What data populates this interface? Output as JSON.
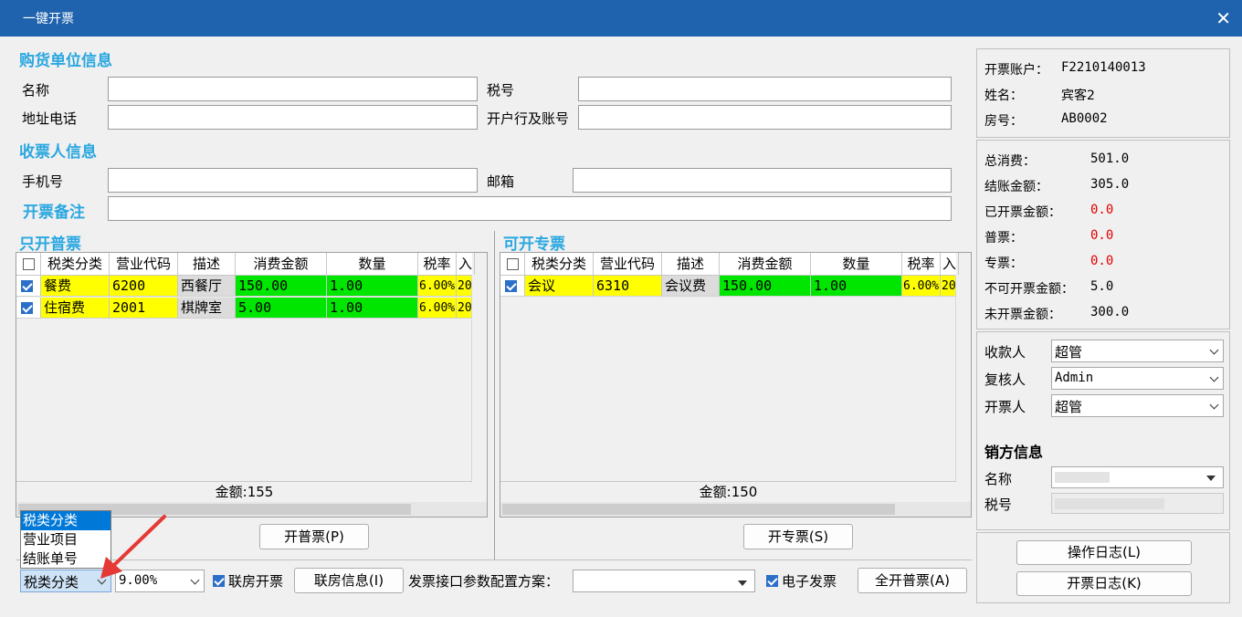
{
  "window": {
    "title": "一键开票",
    "close": "✕"
  },
  "buyer": {
    "section_title": "购货单位信息",
    "name_label": "名称",
    "name_value": "",
    "tax_label": "税号",
    "tax_value": "",
    "address_label": "地址电话",
    "address_value": "",
    "bank_label": "开户行及账号",
    "bank_value": ""
  },
  "receiver": {
    "section_title": "收票人信息",
    "phone_label": "手机号",
    "phone_value": "",
    "email_label": "邮箱",
    "email_value": "",
    "remark_label": "开票备注",
    "remark_value": ""
  },
  "general_invoice": {
    "title": "只开普票",
    "columns": [
      "税类分类",
      "营业代码",
      "描述",
      "消费金额",
      "数量",
      "税率",
      "入"
    ],
    "rows": [
      {
        "category": "餐费",
        "code": "6200",
        "desc": "西餐厅",
        "amount": "150.00",
        "qty": "1.00",
        "rate": "6.00%",
        "extra": "20"
      },
      {
        "category": "住宿费",
        "code": "2001",
        "desc": "棋牌室",
        "amount": "5.00",
        "qty": "1.00",
        "rate": "6.00%",
        "extra": "20"
      }
    ],
    "footer": "金额:155",
    "button": "开普票(P)"
  },
  "special_invoice": {
    "title": "可开专票",
    "columns": [
      "税类分类",
      "营业代码",
      "描述",
      "消费金额",
      "数量",
      "税率",
      "入"
    ],
    "rows": [
      {
        "category": "会议",
        "code": "6310",
        "desc": "会议费",
        "amount": "150.00",
        "qty": "1.00",
        "rate": "6.00%",
        "extra": "20"
      }
    ],
    "footer": "金额:150",
    "button": "开专票(S)"
  },
  "account": {
    "account_label": "开票账户：",
    "account_value": "F2210140013",
    "name_label": "姓名：",
    "name_value": "宾客2",
    "room_label": "房号：",
    "room_value": "AB0002"
  },
  "summary": [
    {
      "label": "总消费：",
      "value": "501.0",
      "color": "#000000"
    },
    {
      "label": "结账金额：",
      "value": "305.0",
      "color": "#000000"
    },
    {
      "label": "已开票金额：",
      "value": "0.0",
      "color": "#e00000"
    },
    {
      "label": "普票：",
      "value": "0.0",
      "color": "#e00000"
    },
    {
      "label": "专票：",
      "value": "0.0",
      "color": "#e00000"
    },
    {
      "label": "不可开票金额：",
      "value": "5.0",
      "color": "#000000"
    },
    {
      "label": "未开票金额：",
      "value": "300.0",
      "color": "#000000"
    }
  ],
  "staff": {
    "payee_label": "收款人",
    "payee_value": "超管",
    "reviewer_label": "复核人",
    "reviewer_value": "Admin",
    "issuer_label": "开票人",
    "issuer_value": "超管"
  },
  "seller": {
    "title": "销方信息",
    "name_label": "名称",
    "name_value": "",
    "tax_label": "税号",
    "tax_value": ""
  },
  "logs": {
    "operation_log": "操作日志(L)",
    "invoice_log": "开票日志(K)"
  },
  "bottom": {
    "group_select": "税类分类",
    "group_options": [
      "税类分类",
      "营业项目",
      "结账单号"
    ],
    "rate_select": "9.00%",
    "room_link_checkbox": "联房开票",
    "room_info_button": "联房信息(I)",
    "config_label": "发票接口参数配置方案：",
    "config_value": "",
    "einvoice_checkbox": "电子发票",
    "issue_all_button": "全开普票(A)"
  },
  "colors": {
    "accent": "#2aa7e0",
    "titlebar": "#1f62ad",
    "highlight_yellow": "#ffff00",
    "highlight_green": "#00e600",
    "arrow": "#e53935"
  }
}
